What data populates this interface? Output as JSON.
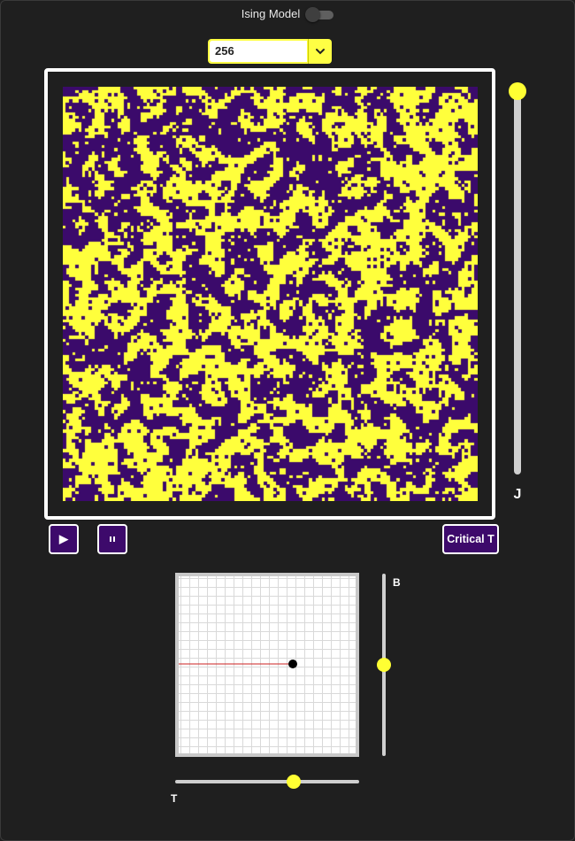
{
  "header": {
    "title": "Ising Model",
    "toggle_on": false
  },
  "lattice_size": {
    "selected": "256",
    "arrow_icon": "chevron-down-icon"
  },
  "lattice": {
    "spin_up_color": "#ffff3c",
    "spin_down_color": "#3b0a6b"
  },
  "sliders": {
    "j": {
      "label": "J",
      "level": 1.0
    },
    "b": {
      "label": "B",
      "level": 0.5
    },
    "t": {
      "label": "T",
      "level": 0.64
    }
  },
  "controls": {
    "play_icon": "play-icon",
    "play_label": "▶",
    "pause_icon": "pause-icon",
    "pause_label": "⏸",
    "critical_label": "Critical T"
  },
  "phase_pad": {
    "marker_color": "#000000",
    "line_color": "#cc2222"
  },
  "colors": {
    "accent": "#ffff33",
    "button_bg": "#3d0a6b",
    "background": "#1f1f1f"
  }
}
